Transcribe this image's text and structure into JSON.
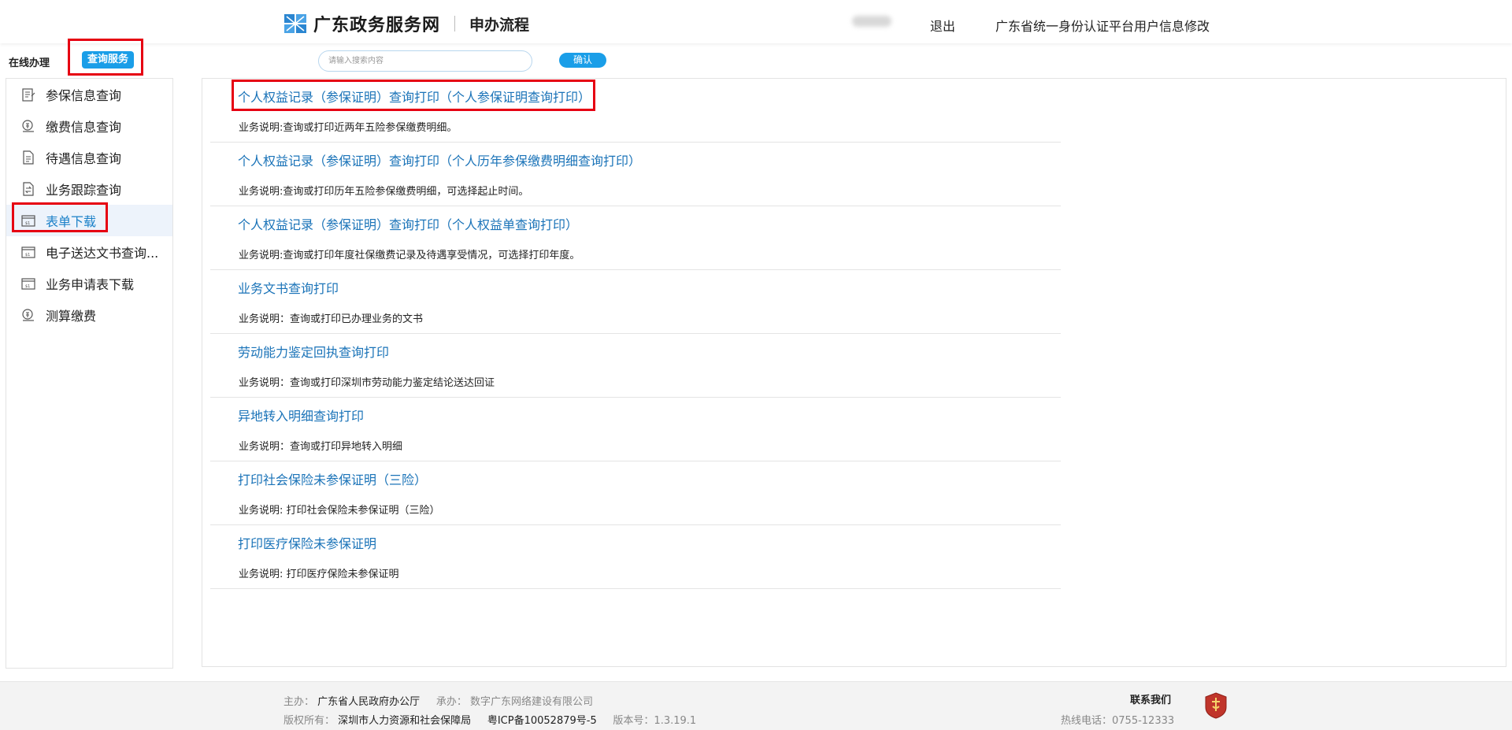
{
  "header": {
    "site_name": "广东政务服务网",
    "sub_title": "申办流程",
    "logout": "退出",
    "profile_modify": "广东省统一身份认证平台用户信息修改"
  },
  "toolbar": {
    "online_label": "在线办理",
    "query_tab": "查询服务",
    "search_placeholder": "请输入搜索内容",
    "confirm": "确认"
  },
  "sidebar": {
    "items": [
      {
        "label": "参保信息查询",
        "icon": "form-icon"
      },
      {
        "label": "缴费信息查询",
        "icon": "coin-icon"
      },
      {
        "label": "待遇信息查询",
        "icon": "document-icon"
      },
      {
        "label": "业务跟踪查询",
        "icon": "transfer-icon"
      },
      {
        "label": "表单下载",
        "icon": "form-download-icon"
      },
      {
        "label": "电子送达文书查询...",
        "icon": "form-download-icon"
      },
      {
        "label": "业务申请表下载",
        "icon": "form-download-icon"
      },
      {
        "label": "测算缴费",
        "icon": "coin-icon"
      }
    ],
    "active_index": 4
  },
  "services": [
    {
      "title": "个人权益记录（参保证明）查询打印（个人参保证明查询打印）",
      "desc": "业务说明:查询或打印近两年五险参保缴费明细。"
    },
    {
      "title": "个人权益记录（参保证明）查询打印（个人历年参保缴费明细查询打印）",
      "desc": "业务说明:查询或打印历年五险参保缴费明细，可选择起止时间。"
    },
    {
      "title": "个人权益记录（参保证明）查询打印（个人权益单查询打印）",
      "desc": "业务说明:查询或打印年度社保缴费记录及待遇享受情况，可选择打印年度。"
    },
    {
      "title": "业务文书查询打印",
      "desc": "业务说明：查询或打印已办理业务的文书"
    },
    {
      "title": "劳动能力鉴定回执查询打印",
      "desc": "业务说明：查询或打印深圳市劳动能力鉴定结论送达回证"
    },
    {
      "title": "异地转入明细查询打印",
      "desc": "业务说明：查询或打印异地转入明细"
    },
    {
      "title": "打印社会保险未参保证明（三险）",
      "desc": "业务说明: 打印社会保险未参保证明（三险）"
    },
    {
      "title": "打印医疗保险未参保证明",
      "desc": "业务说明: 打印医疗保险未参保证明"
    }
  ],
  "footer": {
    "host_label": "主办：",
    "host": "广东省人民政府办公厅",
    "undertake_label": "承办：",
    "undertake": "数字广东网络建设有限公司",
    "copyright_label": "版权所有：",
    "copyright": "深圳市人力资源和社会保障局",
    "icp": "粤ICP备10052879号-5",
    "version_label": "版本号：",
    "version": "1.3.19.1",
    "contact_title": "联系我们",
    "hotline_label": "热线电话：",
    "hotline": "0755-12333"
  },
  "colors": {
    "accent": "#1a9ee8",
    "link": "#1a73b8",
    "highlight_box": "#e60012"
  }
}
